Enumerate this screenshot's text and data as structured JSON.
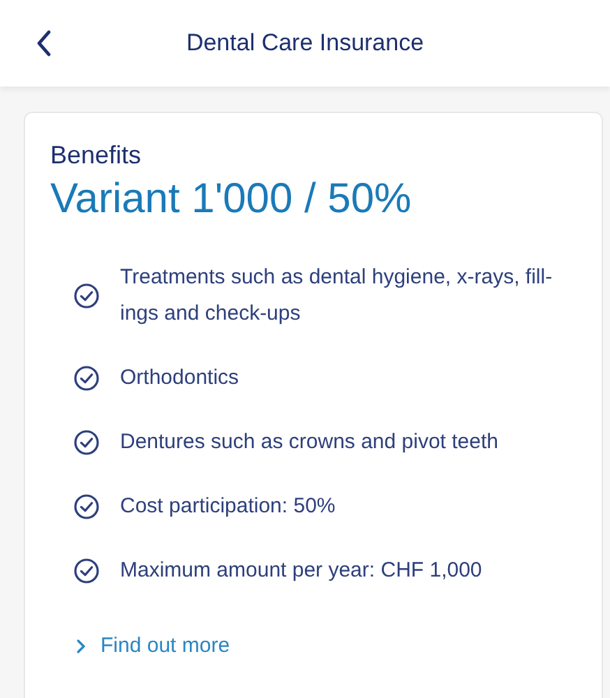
{
  "header": {
    "title": "Dental Care Insurance"
  },
  "card": {
    "heading": "Benefits",
    "variant": "Variant 1'000 / 50%",
    "benefits": [
      {
        "text": "Treatments such as dental hygiene, x-rays, fill-ings and check-ups",
        "included": true
      },
      {
        "text": "Orthodontics",
        "included": true
      },
      {
        "text": "Dentures such as crowns and pivot teeth",
        "included": true
      },
      {
        "text": "Cost participation: 50%",
        "included": true
      },
      {
        "text": "Maximum amount per year: CHF 1,000",
        "included": true
      }
    ],
    "link": "Find out more"
  }
}
